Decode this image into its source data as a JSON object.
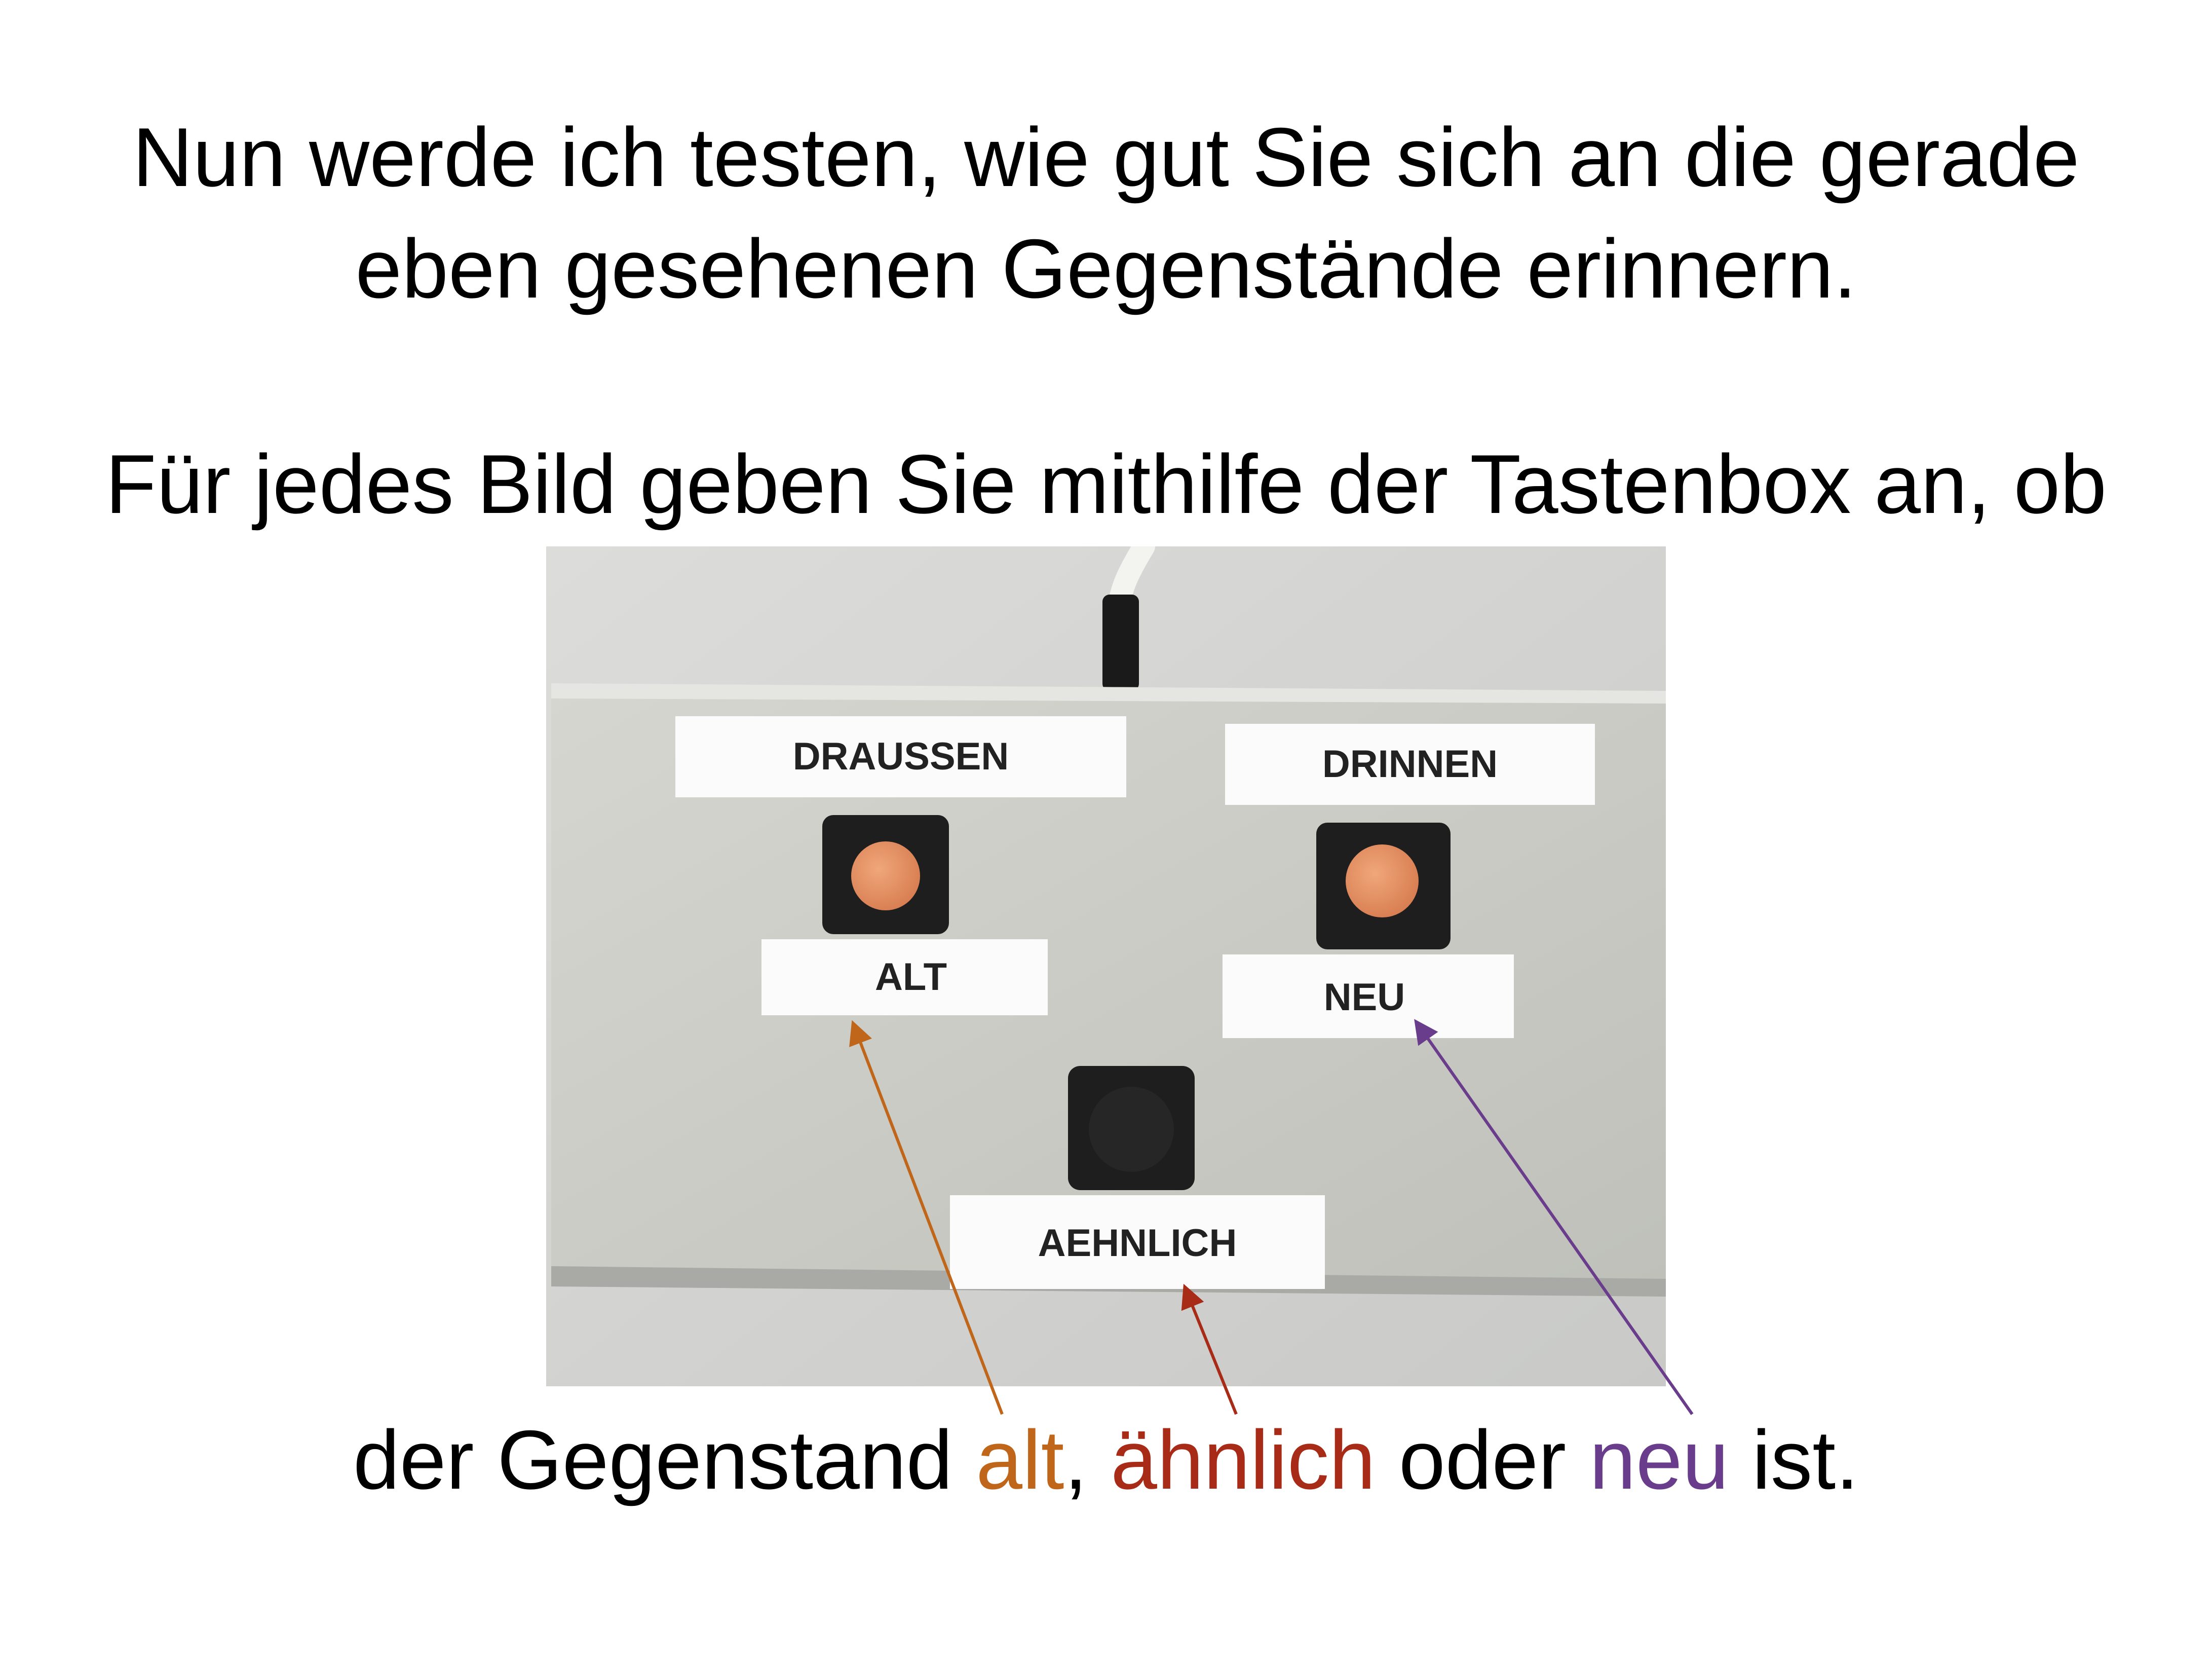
{
  "slide": {
    "intro_line1": "Nun werde ich testen, wie gut Sie sich an die gerade",
    "intro_line2": "eben gesehenen Gegenstände erinnern.",
    "instruction": "Für jedes Bild geben Sie mithilfe der Tastenbox an, ob",
    "bottom_prefix": "der Gegenstand ",
    "bottom_alt": "alt",
    "bottom_sep": ", ",
    "bottom_aehnlich": "ähnlich",
    "bottom_mid": " oder ",
    "bottom_neu": "neu",
    "bottom_suffix": " ist."
  },
  "buttonbox": {
    "label_draussen": "DRAUSSEN",
    "label_drinnen": "DRINNEN",
    "label_alt": "ALT",
    "label_neu": "NEU",
    "label_aehnlich": "AEHNLICH"
  },
  "colors": {
    "alt": "#c0661a",
    "aehnlich": "#a82b17",
    "neu": "#6a3d8c"
  },
  "icons": [
    "cable-icon",
    "orange-button-icon",
    "black-button-icon",
    "arrow-icon"
  ]
}
